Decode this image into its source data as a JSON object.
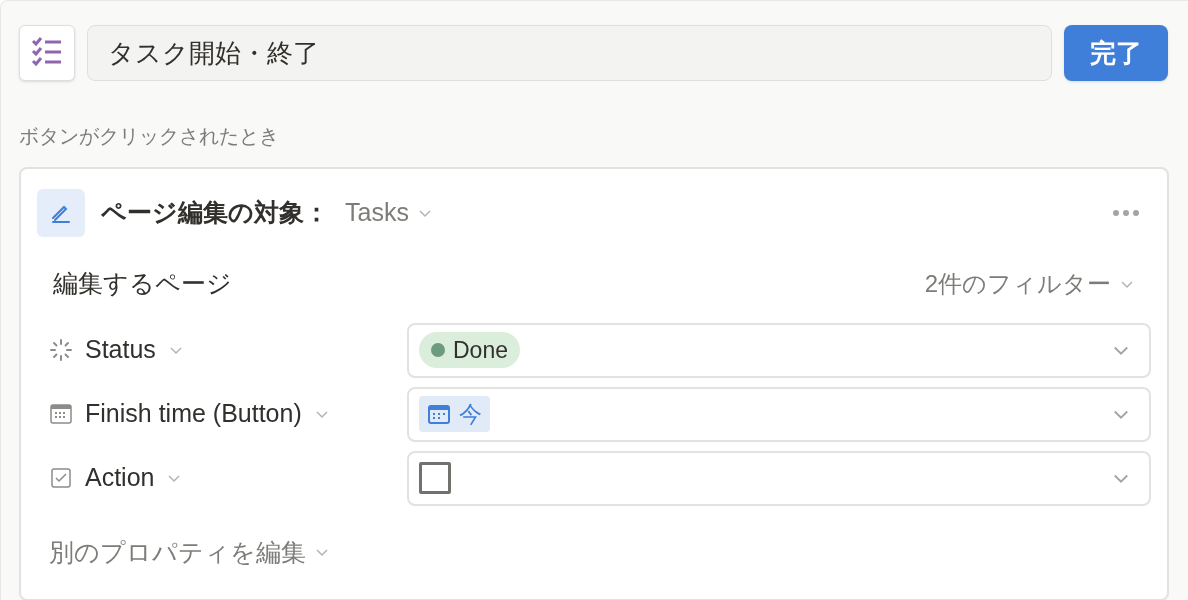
{
  "button_name": {
    "value": "タスク開始・終了"
  },
  "done_button": "完了",
  "trigger_label": "ボタンがクリックされたとき",
  "action": {
    "title": "ページ編集の対象：",
    "database": "Tasks",
    "pages_label": "編集するページ",
    "filter": "2件のフィルター",
    "properties": [
      {
        "kind": "status",
        "name": "Status",
        "value": "Done",
        "color": "#6c9b7d"
      },
      {
        "kind": "date",
        "name": "Finish time (Button)",
        "value": "今"
      },
      {
        "kind": "checkbox",
        "name": "Action",
        "checked": false
      }
    ],
    "more": "別のプロパティを編集"
  }
}
